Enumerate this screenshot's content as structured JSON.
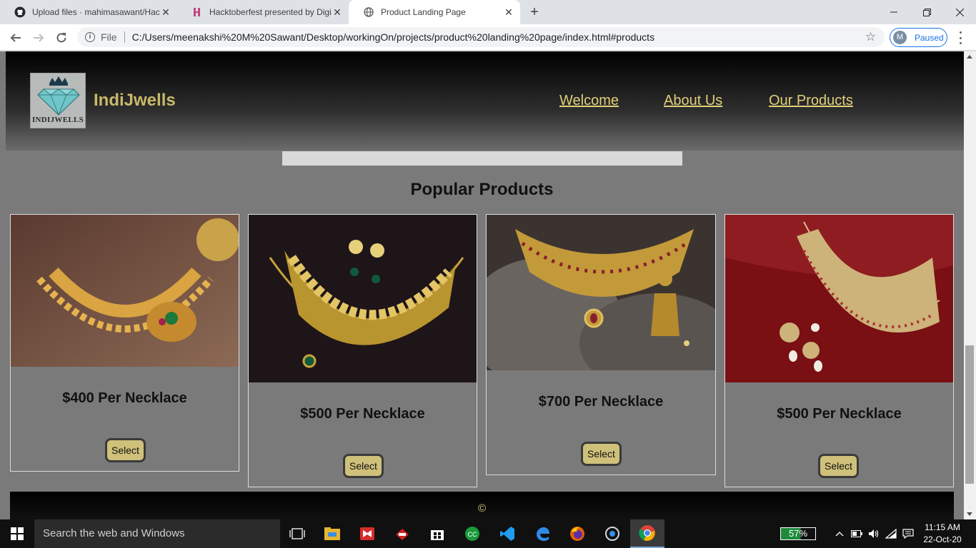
{
  "browser": {
    "tabs": [
      {
        "title": "Upload files · mahimasawant/Hac",
        "favicon": "github-icon"
      },
      {
        "title": "Hacktoberfest presented by Digit",
        "favicon": "hacktoberfest-icon"
      },
      {
        "title": "Product Landing Page",
        "favicon": "globe-icon",
        "active": true
      }
    ],
    "new_tab": "+",
    "file_label": "File",
    "url": "C:/Users/meenakshi%20M%20Sawant/Desktop/workingOn/projects/product%20landing%20page/index.html#products",
    "profile_initial": "M",
    "profile_status": "Paused"
  },
  "page": {
    "logo_text": "INDIJWELLS",
    "brand": "IndiJwells",
    "nav": [
      "Welcome",
      "About Us",
      "Our Products"
    ],
    "section_title": "Popular Products",
    "products": [
      {
        "price": "$400 Per Necklace",
        "button": "Select",
        "image": "gold-necklace-photo-1"
      },
      {
        "price": "$500 Per Necklace",
        "button": "Select",
        "image": "gold-necklace-photo-2"
      },
      {
        "price": "$700 Per Necklace",
        "button": "Select",
        "image": "gold-choker-photo"
      },
      {
        "price": "$500 Per Necklace",
        "button": "Select",
        "image": "gold-necklace-photo-3"
      }
    ],
    "footer_copy": "©"
  },
  "taskbar": {
    "search_placeholder": "Search the web and Windows",
    "battery": "57%",
    "time": "11:15 AM",
    "date": "22-Oct-20"
  },
  "colors": {
    "page_bg": "#7a7a7a",
    "gold_text": "#e0cf7a",
    "button_bg": "#cfc07a"
  }
}
